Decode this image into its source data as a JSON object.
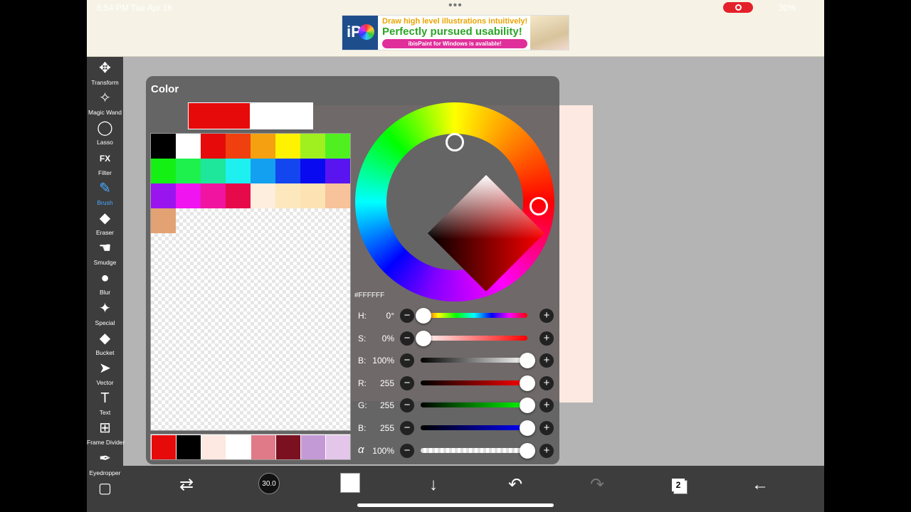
{
  "status": {
    "time": "6:54 PM   Tue Apr 16",
    "dots": "•••",
    "battery": "30%"
  },
  "ad": {
    "logo": "iP",
    "line1": "Draw high level illustrations intuitively!",
    "line2": "Perfectly pursued usability!",
    "line3": "ibisPaint for Windows is available!"
  },
  "toolbar": [
    {
      "label": "Transform",
      "icon": "move-icon"
    },
    {
      "label": "Magic Wand",
      "icon": "magic-wand-icon"
    },
    {
      "label": "Lasso",
      "icon": "lasso-icon"
    },
    {
      "label": "Filter",
      "icon": "filter-icon"
    },
    {
      "label": "Brush",
      "icon": "brush-icon"
    },
    {
      "label": "Eraser",
      "icon": "eraser-icon"
    },
    {
      "label": "Smudge",
      "icon": "smudge-icon"
    },
    {
      "label": "Blur",
      "icon": "blur-icon"
    },
    {
      "label": "Special",
      "icon": "special-icon"
    },
    {
      "label": "Bucket",
      "icon": "bucket-icon"
    },
    {
      "label": "Vector",
      "icon": "vector-icon"
    },
    {
      "label": "Text",
      "icon": "text-icon"
    },
    {
      "label": "Frame Divider",
      "icon": "frame-divider-icon"
    },
    {
      "label": "Eyedropper",
      "icon": "eyedropper-icon"
    }
  ],
  "color_panel": {
    "title": "Color",
    "main_color": "#e60a0a",
    "sub_color": "#ffffff",
    "palette": [
      "#000000",
      "#ffffff",
      "#e60a0a",
      "#f0400f",
      "#f4a010",
      "#fff200",
      "#a0f020",
      "#50f020",
      "#14f014",
      "#1ef04e",
      "#1ee69a",
      "#1ef0f0",
      "#14a0f0",
      "#1446f0",
      "#0a0af0",
      "#5a14f0",
      "#9a14f0",
      "#f014f0",
      "#f014a0",
      "#e60a4a",
      "#fdeedd",
      "#fde8bd",
      "#fde3b4",
      "#f8c29a",
      "#e3a273"
    ],
    "recent": [
      "#e60a0a",
      "#000000",
      "#fde9e1",
      "#ffffff",
      "#e07a88",
      "#7a1020",
      "#c49ad6",
      "#e4c6ea"
    ],
    "hex": "#FFFFFF",
    "sliders": [
      {
        "key": "H:",
        "value": "0°",
        "level": 0
      },
      {
        "key": "S:",
        "value": "0%",
        "level": 0
      },
      {
        "key": "B:",
        "value": "100%",
        "level": 1
      },
      {
        "key": "R:",
        "value": "255",
        "level": 1
      },
      {
        "key": "G:",
        "value": "255",
        "level": 1
      },
      {
        "key": "B:",
        "value": "255",
        "level": 1
      },
      {
        "key": "α",
        "value": "100%",
        "level": 1
      }
    ]
  },
  "bottom": {
    "brush_size": "30.0",
    "layer_count": "2"
  }
}
